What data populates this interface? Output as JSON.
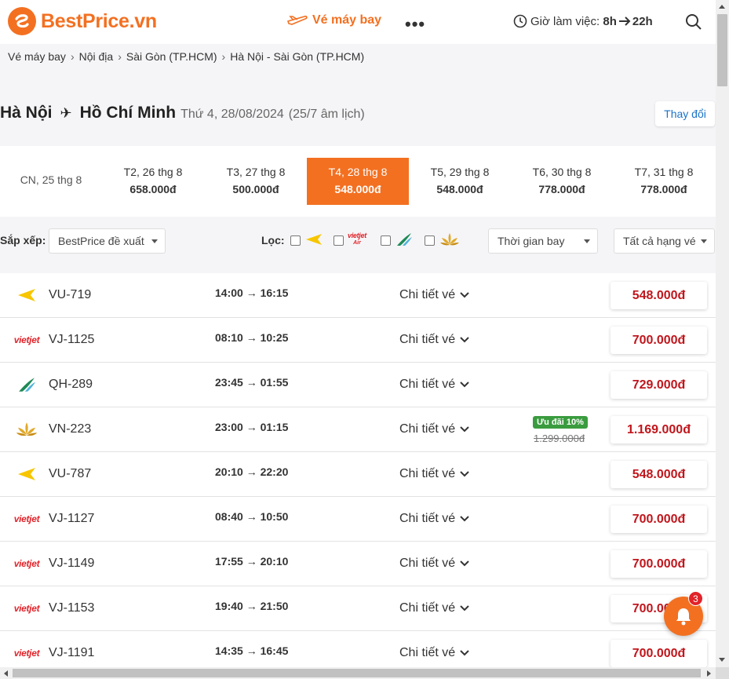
{
  "brand": {
    "name": "BestPrice.vn",
    "color": "#f37021"
  },
  "header": {
    "nav_flights": "Vé máy bay",
    "more": "•••",
    "hours_label": "Giờ làm việc:",
    "hours_from": "8h",
    "hours_to": "22h"
  },
  "breadcrumb": [
    "Vé máy bay",
    "Nội địa",
    "Sài Gòn (TP.HCM)",
    "Hà Nội - Sài Gòn (TP.HCM)"
  ],
  "route": {
    "from": "Hà Nội",
    "to": "Hồ Chí Minh",
    "date": "Thứ 4, 28/08/2024",
    "lunar": "(25/7 âm lịch)",
    "change_label": "Thay đổi"
  },
  "dates": [
    {
      "day": "CN, 25 thg 8",
      "price": ""
    },
    {
      "day": "T2, 26 thg 8",
      "price": "658.000đ"
    },
    {
      "day": "T3, 27 thg 8",
      "price": "500.000đ"
    },
    {
      "day": "T4, 28 thg 8",
      "price": "548.000đ",
      "active": true
    },
    {
      "day": "T5, 29 thg 8",
      "price": "548.000đ"
    },
    {
      "day": "T6, 30 thg 8",
      "price": "778.000đ"
    },
    {
      "day": "T7, 31 thg 8",
      "price": "778.000đ"
    }
  ],
  "filters": {
    "sort_label": "Sắp xếp:",
    "sort_value": "BestPrice đề xuất",
    "filter_label": "Lọc:",
    "airline_filters": [
      "vietravel-icon",
      "vietjet-air-icon",
      "bamboo-icon",
      "vietnam-airlines-icon"
    ],
    "time_select": "Thời gian bay",
    "class_select": "Tất cả hạng vé"
  },
  "flights": [
    {
      "airline": "vietravel",
      "code": "VU-719",
      "depart": "14:00",
      "arrive": "16:15",
      "detail": "Chi tiết vé",
      "price": "548.000đ"
    },
    {
      "airline": "vietjet",
      "code": "VJ-1125",
      "depart": "08:10",
      "arrive": "10:25",
      "detail": "Chi tiết vé",
      "price": "700.000đ"
    },
    {
      "airline": "bamboo",
      "code": "QH-289",
      "depart": "23:45",
      "arrive": "01:55",
      "detail": "Chi tiết vé",
      "price": "729.000đ"
    },
    {
      "airline": "vietnam",
      "code": "VN-223",
      "depart": "23:00",
      "arrive": "01:15",
      "detail": "Chi tiết vé",
      "price": "1.169.000đ",
      "promo": "Ưu đãi 10%",
      "old_price": "1.299.000đ"
    },
    {
      "airline": "vietravel",
      "code": "VU-787",
      "depart": "20:10",
      "arrive": "22:20",
      "detail": "Chi tiết vé",
      "price": "548.000đ"
    },
    {
      "airline": "vietjet",
      "code": "VJ-1127",
      "depart": "08:40",
      "arrive": "10:50",
      "detail": "Chi tiết vé",
      "price": "700.000đ"
    },
    {
      "airline": "vietjet",
      "code": "VJ-1149",
      "depart": "17:55",
      "arrive": "20:10",
      "detail": "Chi tiết vé",
      "price": "700.000đ"
    },
    {
      "airline": "vietjet",
      "code": "VJ-1153",
      "depart": "19:40",
      "arrive": "21:50",
      "detail": "Chi tiết vé",
      "price": "700.000đ"
    },
    {
      "airline": "vietjet",
      "code": "VJ-1191",
      "depart": "14:35",
      "arrive": "16:45",
      "detail": "Chi tiết vé",
      "price": "700.000đ"
    }
  ],
  "airline_labels": {
    "vietjet": "vietjet",
    "vietjet_air": "vietjet Air"
  },
  "notifications": {
    "count": "3"
  },
  "colors": {
    "accent": "#f37021",
    "price": "#c0161c",
    "promo": "#3a9c3f",
    "link": "#1a73c8"
  }
}
